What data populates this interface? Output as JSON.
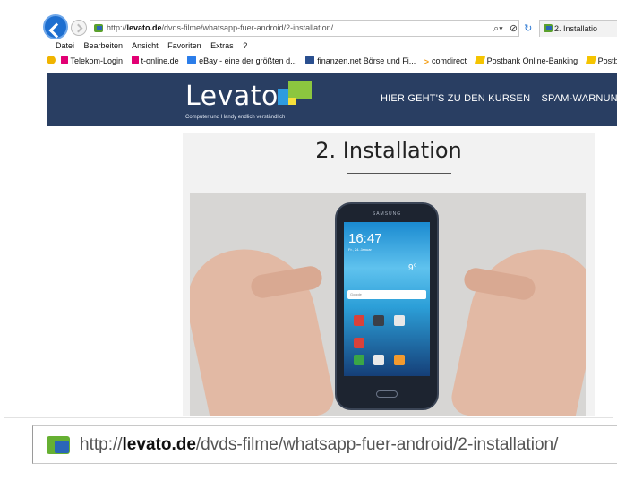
{
  "browser": {
    "url": {
      "prefix": "http://",
      "domain": "levato.de",
      "path": "/dvds-filme/whatsapp-fuer-android/2-installation/"
    },
    "tab_title": "2. Installatio",
    "menu": [
      "Datei",
      "Bearbeiten",
      "Ansicht",
      "Favoriten",
      "Extras",
      "?"
    ],
    "favorites": [
      {
        "icon": "telekom-icon",
        "label": "Telekom-Login"
      },
      {
        "icon": "telekom-icon",
        "label": "t-online.de"
      },
      {
        "icon": "ebay-icon",
        "label": "eBay - eine der größten d..."
      },
      {
        "icon": "chart-icon",
        "label": "finanzen.net Börse und Fi..."
      },
      {
        "icon": "arrow-icon",
        "label": "comdirect"
      },
      {
        "icon": "postbank-icon",
        "label": "Postbank Online-Banking"
      },
      {
        "icon": "postbank-icon",
        "label": "Postban"
      }
    ]
  },
  "site": {
    "logo_text": "Levato",
    "logo_tagline": "Computer und Handy endlich verständlich",
    "nav": [
      "HIER GEHT'S ZU DEN KURSEN",
      "SPAM-WARNUN"
    ],
    "page_title": "2. Installation"
  },
  "video": {
    "brand": "SAMSUNG",
    "clock": "16:47",
    "date": "Fr., 24. Januar",
    "temperature": "9°",
    "search_hint": "Google",
    "colors": {
      "header": "#293e62",
      "logo_blue": "#2e9be0",
      "logo_green": "#8cc63f",
      "logo_yellow": "#f7e03b"
    }
  },
  "zoomed_url": {
    "prefix": "http://",
    "domain": "levato.de",
    "path": "/dvds-filme/whatsapp-fuer-android/2-installation/"
  }
}
